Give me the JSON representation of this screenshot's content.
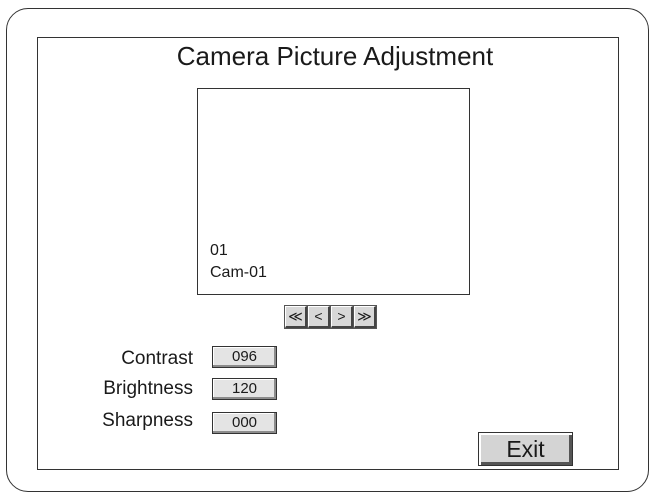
{
  "title": "Camera Picture Adjustment",
  "preview": {
    "channel_number": "01",
    "camera_name": "Cam-01"
  },
  "navigation": {
    "first": "≪",
    "prev": "<",
    "next": ">",
    "last": "≫"
  },
  "settings": [
    {
      "label": "Contrast",
      "value": "096"
    },
    {
      "label": "Brightness",
      "value": "120"
    },
    {
      "label": "Sharpness",
      "value": "000"
    }
  ],
  "exit_label": "Exit"
}
